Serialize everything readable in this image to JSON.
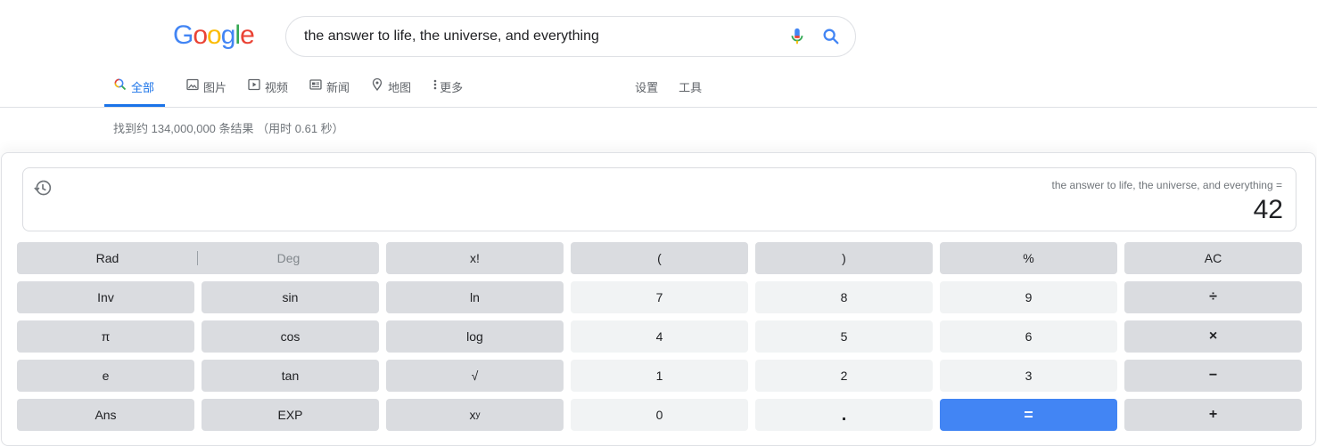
{
  "logo": {
    "letters": [
      {
        "char": "G",
        "color": "#4285f4"
      },
      {
        "char": "o",
        "color": "#ea4335"
      },
      {
        "char": "o",
        "color": "#fbbc05"
      },
      {
        "char": "g",
        "color": "#4285f4"
      },
      {
        "char": "l",
        "color": "#34a853"
      },
      {
        "char": "e",
        "color": "#ea4335"
      }
    ]
  },
  "search": {
    "value": "the answer to life, the universe, and everything"
  },
  "tabs": [
    {
      "label": "全部",
      "icon": "search-icon"
    },
    {
      "label": "图片",
      "icon": "image-icon"
    },
    {
      "label": "视频",
      "icon": "video-icon"
    },
    {
      "label": "新闻",
      "icon": "news-icon"
    },
    {
      "label": "地图",
      "icon": "map-pin-icon"
    },
    {
      "label": "更多",
      "icon": "more-vert-icon"
    },
    {
      "label": "设置"
    },
    {
      "label": "工具"
    }
  ],
  "result_stats": "找到约 134,000,000 条结果 （用时 0.61 秒）",
  "calculator": {
    "expression": "the answer to life, the universe, and everything =",
    "result": "42",
    "mode": {
      "rad": "Rad",
      "deg": "Deg"
    },
    "keys": {
      "fact": "x!",
      "lparen": "(",
      "rparen": ")",
      "percent": "%",
      "ac": "AC",
      "inv": "Inv",
      "sin": "sin",
      "ln": "ln",
      "seven": "7",
      "eight": "8",
      "nine": "9",
      "divide": "÷",
      "pi": "π",
      "cos": "cos",
      "log": "log",
      "four": "4",
      "five": "5",
      "six": "6",
      "multiply": "×",
      "e": "e",
      "tan": "tan",
      "sqrt": "√",
      "one": "1",
      "two": "2",
      "three": "3",
      "minus": "−",
      "ans": "Ans",
      "exp": "EXP",
      "pow_base": "x",
      "pow_exp": "y",
      "zero": "0",
      "dot": ".",
      "equals": "=",
      "plus": "+"
    }
  },
  "colors": {
    "accent": "#1a73e8",
    "equals_key": "#4285f4",
    "function_key": "#dadce0",
    "number_key": "#f1f3f4"
  }
}
